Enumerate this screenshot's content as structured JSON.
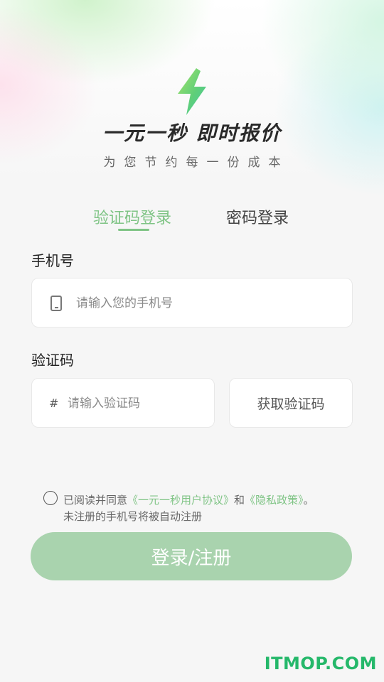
{
  "header": {
    "logo_icon": "lightning-icon",
    "slogan": "一元一秒  即时报价",
    "subtitle": "为您节约每一份成本"
  },
  "tabs": [
    {
      "label": "验证码登录",
      "active": true
    },
    {
      "label": "密码登录",
      "active": false
    }
  ],
  "phone": {
    "label": "手机号",
    "icon": "phone-icon",
    "placeholder": "请输入您的手机号",
    "value": ""
  },
  "code": {
    "label": "验证码",
    "icon": "hash-icon",
    "icon_glyph": "#",
    "placeholder": "请输入验证码",
    "value": "",
    "get_code_label": "获取验证码"
  },
  "agreement": {
    "checked": false,
    "prefix": "已阅读并同意",
    "user_agreement": "《一元一秒用户协议》",
    "and": "和",
    "privacy_policy": "《隐私政策》",
    "suffix": "。",
    "note": "未注册的手机号将被自动注册"
  },
  "submit_label": "登录/注册",
  "watermark": "ITMOP.COM",
  "colors": {
    "accent": "#7fc485",
    "button": "#a9d3ae",
    "watermark": "#25b86a"
  }
}
